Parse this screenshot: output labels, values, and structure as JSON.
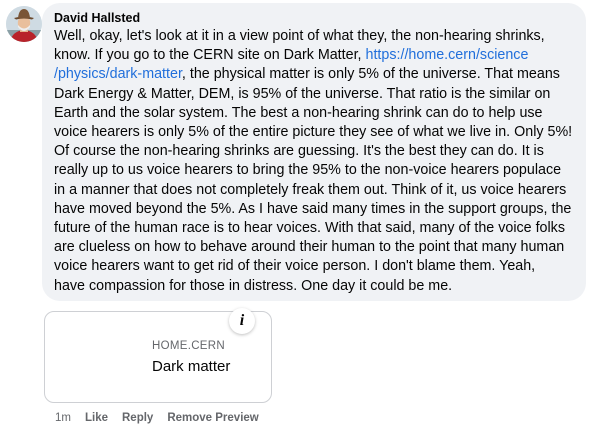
{
  "comment": {
    "author": "David Hallsted",
    "lines": [
      "Well, okay, let's look at it in a view point of what they, the non-hearing shrinks,",
      "know. If you go to the CERN site on Dark Matter, ",
      ", the physical matter is only 5% of the universe. That means",
      "Dark Energy & Matter, DEM, is 95% of the universe. That ratio is the similar on",
      "Earth and the solar system. The best a non-hearing shrink can do to help use",
      "voice hearers is only 5% of the entire picture they see of what we live in. Only 5%!",
      "Of course the non-hearing shrinks are guessing. It's the best they can do. It is",
      "really up to us voice hearers to bring the 95% to the non-voice hearers populace",
      "in a manner that does not completely freak them out. Think of it, us voice hearers",
      "have moved beyond the 5%. As I have said many times in the support groups, the",
      "future of the human race is to hear voices. With that said, many of the voice folks",
      "are clueless on how to behave around their human to the point that many human",
      "voice hearers want to get rid of their voice person. I don't blame them. Yeah,",
      "have compassion for those in distress. One day it could be me."
    ],
    "link_part1": "https://home.cern/science",
    "link_part2": "/physics/dark-matter"
  },
  "preview": {
    "domain": "HOME.CERN",
    "title": "Dark matter",
    "info_glyph": "i"
  },
  "actions": {
    "time": "1m",
    "like": "Like",
    "reply": "Reply",
    "remove_preview": "Remove Preview"
  },
  "colors": {
    "bubble": "#f0f2f5",
    "link": "#216fdb",
    "meta": "#65676b"
  }
}
